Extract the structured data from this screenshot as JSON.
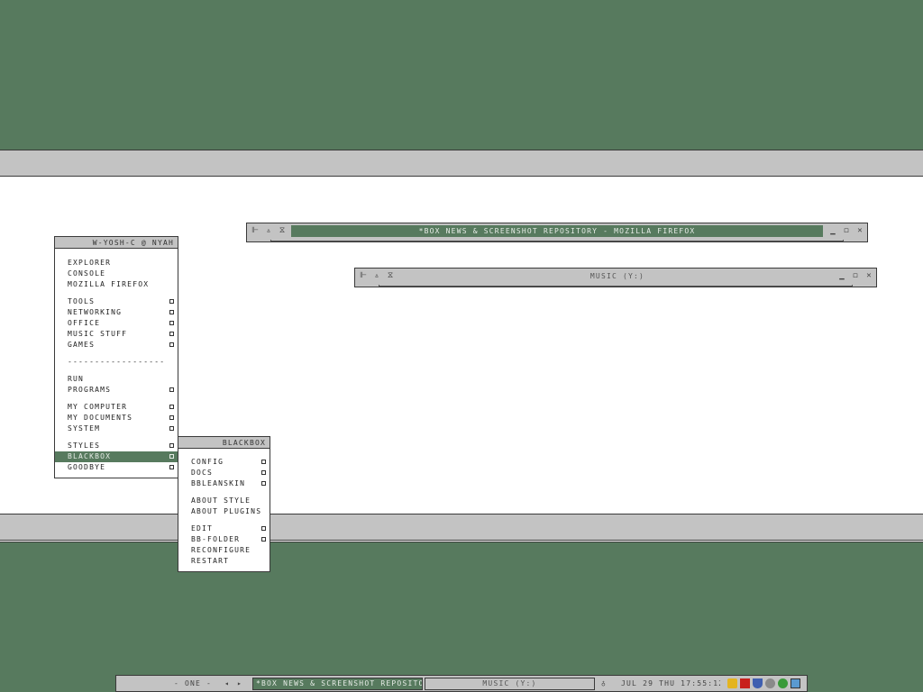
{
  "firefox_window": {
    "title": "*BOX NEWS & SCREENSHOT REPOSITORY - MOZILLA FIREFOX"
  },
  "music_window": {
    "title": "MUSIC (Y:)"
  },
  "root_menu": {
    "title": "W-YOSH-C @ NYAH",
    "items": [
      {
        "label": "EXPLORER"
      },
      {
        "label": "CONSOLE"
      },
      {
        "label": "MOZILLA FIREFOX"
      },
      {
        "label": "TOOLS"
      },
      {
        "label": "NETWORKING"
      },
      {
        "label": "OFFICE"
      },
      {
        "label": "MUSIC STUFF"
      },
      {
        "label": "GAMES"
      },
      {
        "label": "------------------"
      },
      {
        "label": "RUN"
      },
      {
        "label": "PROGRAMS"
      },
      {
        "label": "MY COMPUTER"
      },
      {
        "label": "MY DOCUMENTS"
      },
      {
        "label": "SYSTEM"
      },
      {
        "label": "STYLES"
      },
      {
        "label": "BLACKBOX"
      },
      {
        "label": "GOODBYE"
      }
    ]
  },
  "blackbox_menu": {
    "title": "BLACKBOX",
    "items": [
      {
        "label": "CONFIG"
      },
      {
        "label": "DOCS"
      },
      {
        "label": "BBLEANSKIN"
      },
      {
        "label": "ABOUT STYLE"
      },
      {
        "label": "ABOUT PLUGINS"
      },
      {
        "label": "EDIT"
      },
      {
        "label": "BB-FOLDER"
      },
      {
        "label": "RECONFIGURE"
      },
      {
        "label": "RESTART"
      }
    ]
  },
  "taskbar": {
    "workspace": "- ONE -",
    "prev": "◂",
    "next": "▸",
    "tasks": [
      {
        "label": "*BOX NEWS & SCREENSHOT REPOSITO..."
      },
      {
        "label": "MUSIC (Y:)"
      }
    ],
    "clock": "JUL 29 THU 17:55:12"
  },
  "colors": {
    "desktop": "#577a5e",
    "frame": "#c3c3c3",
    "active": "#577a5e"
  }
}
